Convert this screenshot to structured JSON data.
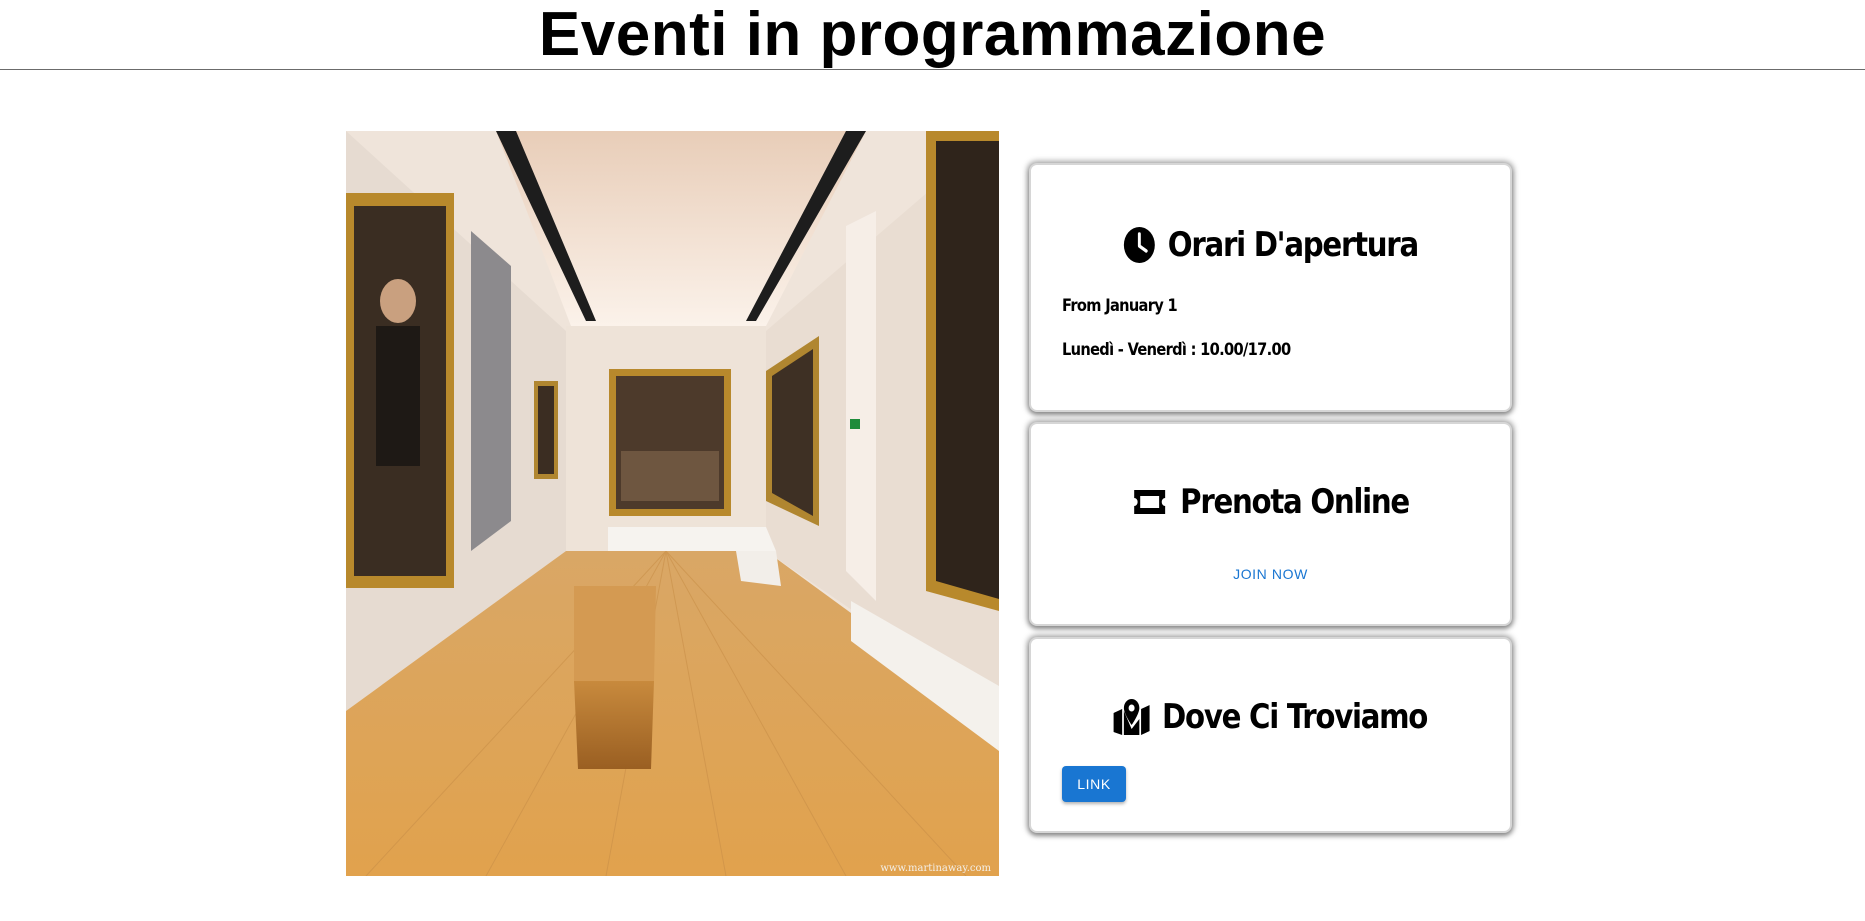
{
  "header": {
    "title": "Eventi in programmazione"
  },
  "photo": {
    "description_icon": "gallery-photo",
    "watermark": "www.martinaway.com"
  },
  "cards": {
    "hours": {
      "icon": "clock-icon",
      "title": "Orari D'apertura",
      "from": "From January 1",
      "weekdays": "Lunedì - Venerdì : 10.00/17.00"
    },
    "booking": {
      "icon": "ticket-icon",
      "title": "Prenota Online",
      "join_label": "JOIN NOW"
    },
    "location": {
      "icon": "map-location-icon",
      "title": "Dove Ci Troviamo",
      "link_label": "LINK"
    }
  },
  "colors": {
    "accent": "#1976d2",
    "text": "#000000",
    "divider": "#6b6b6b"
  }
}
